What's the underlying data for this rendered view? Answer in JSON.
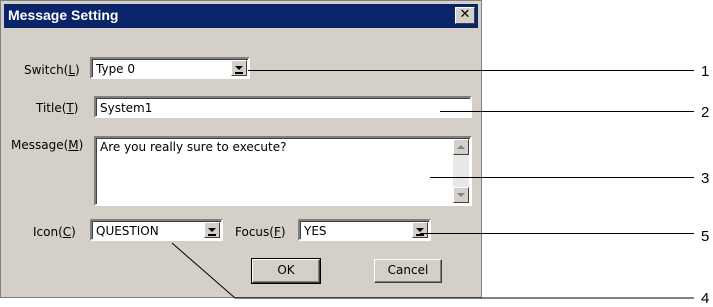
{
  "dialog": {
    "title": "Message Setting",
    "close_glyph": "✕"
  },
  "form": {
    "switch_label_prefix": "Switch(",
    "switch_label_key": "L",
    "switch_label_suffix": ")",
    "switch_value": "Type 0",
    "title_label_prefix": "Title(",
    "title_label_key": "T",
    "title_label_suffix": ")",
    "title_value": "System1",
    "message_label_prefix": "Message(",
    "message_label_key": "M",
    "message_label_suffix": ")",
    "message_value": "Are you really sure to execute?",
    "icon_label_prefix": "Icon(",
    "icon_label_key": "C",
    "icon_label_suffix": ")",
    "icon_value": "QUESTION",
    "focus_label_prefix": "Focus(",
    "focus_label_key": "F",
    "focus_label_suffix": ")",
    "focus_value": "YES"
  },
  "buttons": {
    "ok": "OK",
    "cancel": "Cancel"
  },
  "callouts": [
    "1",
    "2",
    "3",
    "5",
    "4"
  ]
}
